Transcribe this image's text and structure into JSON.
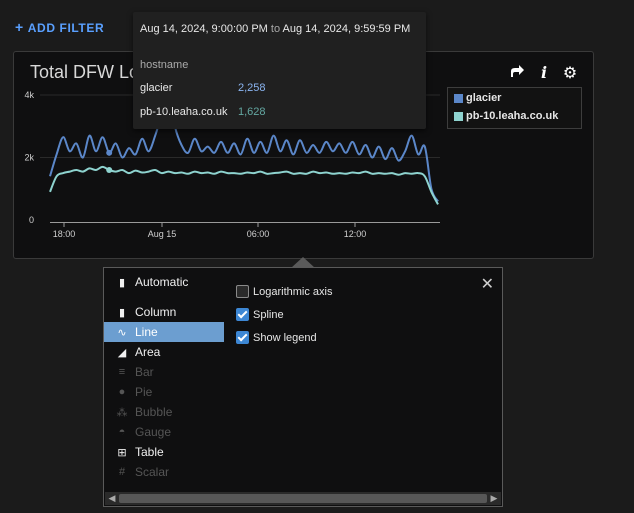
{
  "toolbar": {
    "add_filter_label": "ADD FILTER"
  },
  "panel": {
    "title": "Total DFW Logs",
    "tools": [
      {
        "name": "share-icon"
      },
      {
        "name": "info-icon",
        "glyph": "i"
      },
      {
        "name": "gear-icon",
        "glyph": "⚙"
      }
    ]
  },
  "chart_data": {
    "type": "line",
    "spline": true,
    "log_scale": false,
    "legend_placement": "top-right",
    "title": "Total DFW Logs",
    "yticks": [
      0,
      2000,
      4000
    ],
    "ytick_labels": [
      "0",
      "2k",
      "4k"
    ],
    "xtick_labels": [
      "18:00",
      "Aug 15",
      "06:00",
      "12:00"
    ],
    "ylim": [
      0,
      4000
    ],
    "series": [
      {
        "name": "glacier",
        "color": "#5b87c9",
        "values": [
          1400,
          2100,
          2650,
          2200,
          2450,
          2000,
          2700,
          2200,
          2650,
          2150,
          2450,
          2000,
          2300,
          2100,
          2600,
          2200,
          2700,
          3400,
          4200,
          3000,
          2400,
          2150,
          2600,
          2200,
          2350,
          2150,
          2500,
          2150,
          2450,
          2100,
          2600,
          2150,
          2500,
          2150,
          2700,
          2200,
          2550,
          2100,
          2550,
          2150,
          2400,
          2150,
          2500,
          2200,
          2450,
          2150,
          2500,
          2100,
          2400,
          2000,
          2350,
          1950,
          2300,
          1900,
          2200,
          2700,
          2100,
          2350,
          1000,
          600
        ]
      },
      {
        "name": "pb-10.leaha.co.uk",
        "color": "#8ed3cf",
        "values": [
          900,
          1400,
          1500,
          1550,
          1600,
          1550,
          1650,
          1600,
          1700,
          1600,
          1550,
          1600,
          1500,
          1580,
          1520,
          1550,
          1600,
          1500,
          1550,
          1500,
          1520,
          1480,
          1550,
          1500,
          1520,
          1480,
          1550,
          1500,
          1500,
          1480,
          1520,
          1500,
          1550,
          1480,
          1500,
          1520,
          1550,
          1480,
          1500,
          1480,
          1550,
          1500,
          1520,
          1480,
          1500,
          1480,
          1520,
          1500,
          1550,
          1480,
          1500,
          1480,
          1500,
          1450,
          1500,
          1480,
          1500,
          1400,
          900,
          500
        ]
      }
    ]
  },
  "tooltip": {
    "start": "Aug 14, 2024, 9:00:00 PM",
    "to": "to",
    "end": "Aug 14, 2024, 9:59:59 PM",
    "group_label": "hostname",
    "rows": [
      {
        "name": "glacier",
        "value": "2,258",
        "color": "#8ab4f0"
      },
      {
        "name": "pb-10.leaha.co.uk",
        "value": "1,628",
        "color": "#64a8a2"
      }
    ]
  },
  "chart_options": {
    "types": [
      {
        "label": "Automatic",
        "icon": "bar-chart-icon",
        "glyph": "▮",
        "state": "normal"
      },
      {
        "label": "Column",
        "icon": "column-chart-icon",
        "glyph": "▮",
        "state": "normal"
      },
      {
        "label": "Line",
        "icon": "line-chart-icon",
        "glyph": "∿",
        "state": "selected"
      },
      {
        "label": "Area",
        "icon": "area-chart-icon",
        "glyph": "◢",
        "state": "normal"
      },
      {
        "label": "Bar",
        "icon": "bar-icon",
        "glyph": "≡",
        "state": "disabled"
      },
      {
        "label": "Pie",
        "icon": "pie-chart-icon",
        "glyph": "●",
        "state": "disabled"
      },
      {
        "label": "Bubble",
        "icon": "bubble-chart-icon",
        "glyph": "⁂",
        "state": "disabled"
      },
      {
        "label": "Gauge",
        "icon": "gauge-icon",
        "glyph": "◓",
        "state": "disabled"
      },
      {
        "label": "Table",
        "icon": "table-icon",
        "glyph": "⊞",
        "state": "normal"
      },
      {
        "label": "Scalar",
        "icon": "scalar-icon",
        "glyph": "#",
        "state": "disabled"
      }
    ],
    "options": [
      {
        "label": "Logarithmic axis",
        "checked": false
      },
      {
        "label": "Spline",
        "checked": true
      },
      {
        "label": "Show legend",
        "checked": true
      }
    ]
  }
}
